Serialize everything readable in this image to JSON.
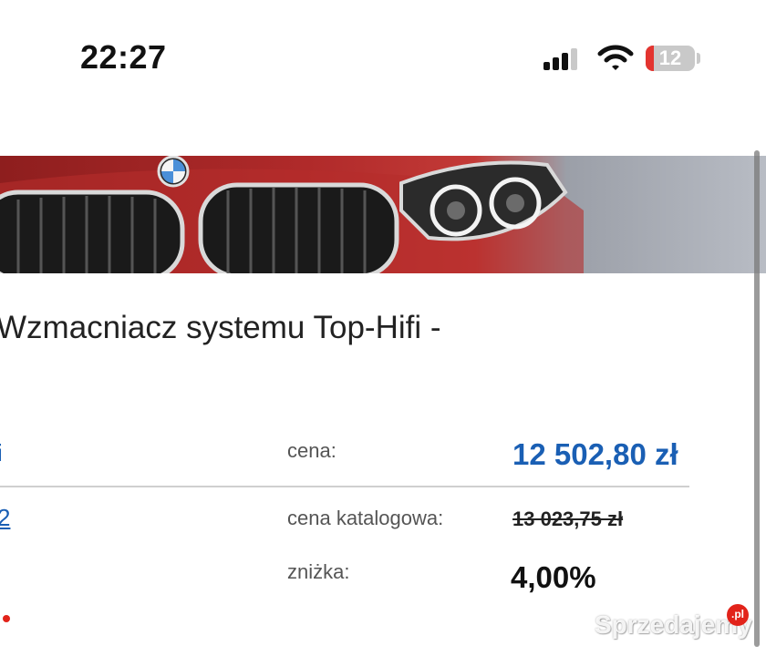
{
  "status_bar": {
    "time": "22:27",
    "battery_level": "12",
    "icons": [
      "cellular-signal-icon",
      "wifi-icon",
      "battery-icon"
    ]
  },
  "product": {
    "title": "Wzmacniacz systemu Top-Hifi -"
  },
  "pricing": {
    "left_link_1": "i",
    "left_link_2": "2",
    "price_label": "cena:",
    "price_value": "12 502,80 zł",
    "catalog_label": "cena katalogowa:",
    "catalog_value": "13 023,75 zł",
    "discount_label": "zniżka:",
    "discount_value": "4,00%"
  },
  "watermark": {
    "text": "Sprzedajemy",
    "badge": ".pl"
  },
  "colors": {
    "accent_blue": "#1a5fb4",
    "battery_low": "#e3342f",
    "brand_red": "#e2231a"
  }
}
